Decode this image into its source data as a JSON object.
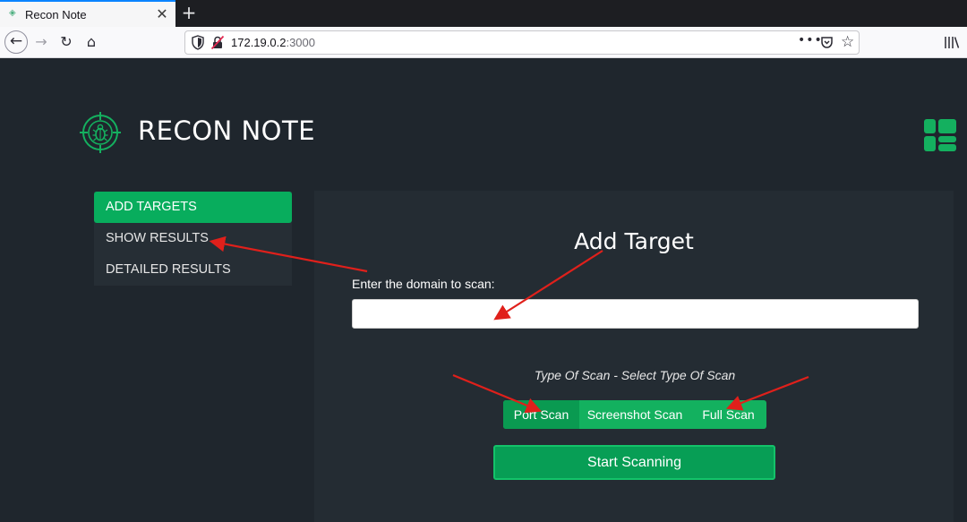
{
  "browser": {
    "tab_title": "Recon Note",
    "close_glyph": "✕",
    "newtab_glyph": "+",
    "url_host": "172.19.0.2",
    "url_port": ":3000",
    "more_glyph": "•••",
    "star_glyph": "☆",
    "back_glyph": "←",
    "forward_glyph": "→",
    "reload_glyph": "↻",
    "home_glyph": "⌂"
  },
  "app": {
    "brand": "RECON NOTE",
    "accent_color": "#08ad5d",
    "background_color": "#1f262d"
  },
  "sidebar": {
    "items": [
      {
        "label": "ADD TARGETS",
        "active": true
      },
      {
        "label": "SHOW RESULTS",
        "active": false
      },
      {
        "label": "DETAILED RESULTS",
        "active": false
      }
    ]
  },
  "form": {
    "title": "Add Target",
    "domain_label": "Enter the domain to scan:",
    "domain_value": "",
    "scan_type_caption": "Type Of Scan - Select Type Of Scan",
    "scan_types": [
      {
        "label": "Port Scan",
        "active": true
      },
      {
        "label": "Screenshot Scan",
        "active": false
      },
      {
        "label": "Full Scan",
        "active": false
      }
    ],
    "submit_label": "Start Scanning"
  },
  "annotations": {
    "arrow_color": "#e0201b",
    "arrow_count": 4
  }
}
